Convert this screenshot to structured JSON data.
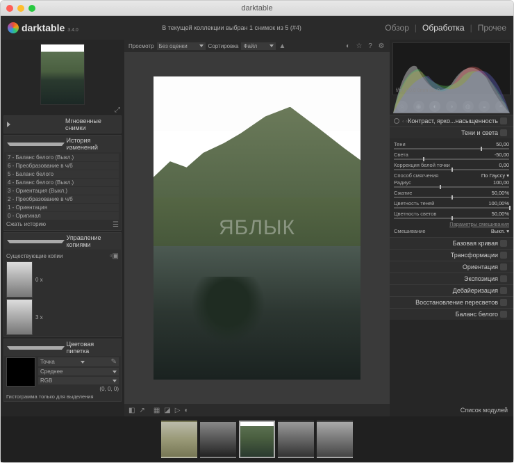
{
  "window": {
    "title": "darktable"
  },
  "brand": {
    "name": "darktable",
    "version": "3.4.0"
  },
  "collection_info": "В текущей коллекции выбран 1 снимок из 5 (#4)",
  "tabs": {
    "overview": "Обзор",
    "darkroom": "Обработка",
    "other": "Прочее"
  },
  "center_toolbar": {
    "view_label": "Просмотр",
    "view_value": "Без оценки",
    "sort_label": "Сортировка",
    "sort_value": "Файл"
  },
  "watermark": "ЯБЛЫК",
  "left": {
    "snapshots": "Мгновенные снимки",
    "history": {
      "title": "История изменений",
      "items": [
        "7 - Баланс белого (Выкл.)",
        "6 - Преобразование в ч/б",
        "5 - Баланс белого",
        "4 - Баланс белого (Выкл.)",
        "3 - Ориентация (Выкл.)",
        "2 - Преобразование в ч/б",
        "1 - Ориентация",
        "0 - Оригинал"
      ],
      "compress": "Сжать историю"
    },
    "duplicates": {
      "title": "Управление копиями",
      "existing": "Существующие копии",
      "items": [
        {
          "suffix": "0 x"
        },
        {
          "suffix": "3 x"
        }
      ]
    },
    "pipette": {
      "title": "Цветовая пипетка",
      "mode": "Точка",
      "stat": "Среднее",
      "space": "RGB",
      "value": "(0, 0, 0)",
      "note": "Гистограмма только для выделения"
    }
  },
  "right": {
    "histo_info": "f/inf 1/0.0 0mm iso 0",
    "active_module": {
      "prefix_label": "Контраст, ярко...насыщенность",
      "title": "Тени и света",
      "sliders": [
        {
          "name": "Тени",
          "value": "50,00",
          "pos": 75
        },
        {
          "name": "Света",
          "value": "-50,00",
          "pos": 25
        },
        {
          "name": "Коррекция белой точки",
          "value": "0,00",
          "pos": 50
        },
        {
          "name": "Способ смягчения",
          "value": "По Гауссу",
          "dd": true
        },
        {
          "name": "Радиус",
          "value": "100,00",
          "pos": 40
        },
        {
          "name": "Сжатие",
          "value": "50,00%",
          "pos": 50
        },
        {
          "name": "Цветность теней",
          "value": "100,00%",
          "pos": 100
        },
        {
          "name": "Цветность светов",
          "value": "50,00%",
          "pos": 50
        }
      ],
      "blend_label": "Параметры смешивания",
      "blend_mode_label": "Смешивание",
      "blend_mode_value": "Выкл."
    },
    "modules": [
      "Базовая кривая",
      "Трансформации",
      "Ориентация",
      "Экспозиция",
      "Дебайеризация",
      "Восстановление пересветов",
      "Баланс белого"
    ],
    "module_list": "Список модулей"
  },
  "filmstrip": {
    "count": 5
  }
}
